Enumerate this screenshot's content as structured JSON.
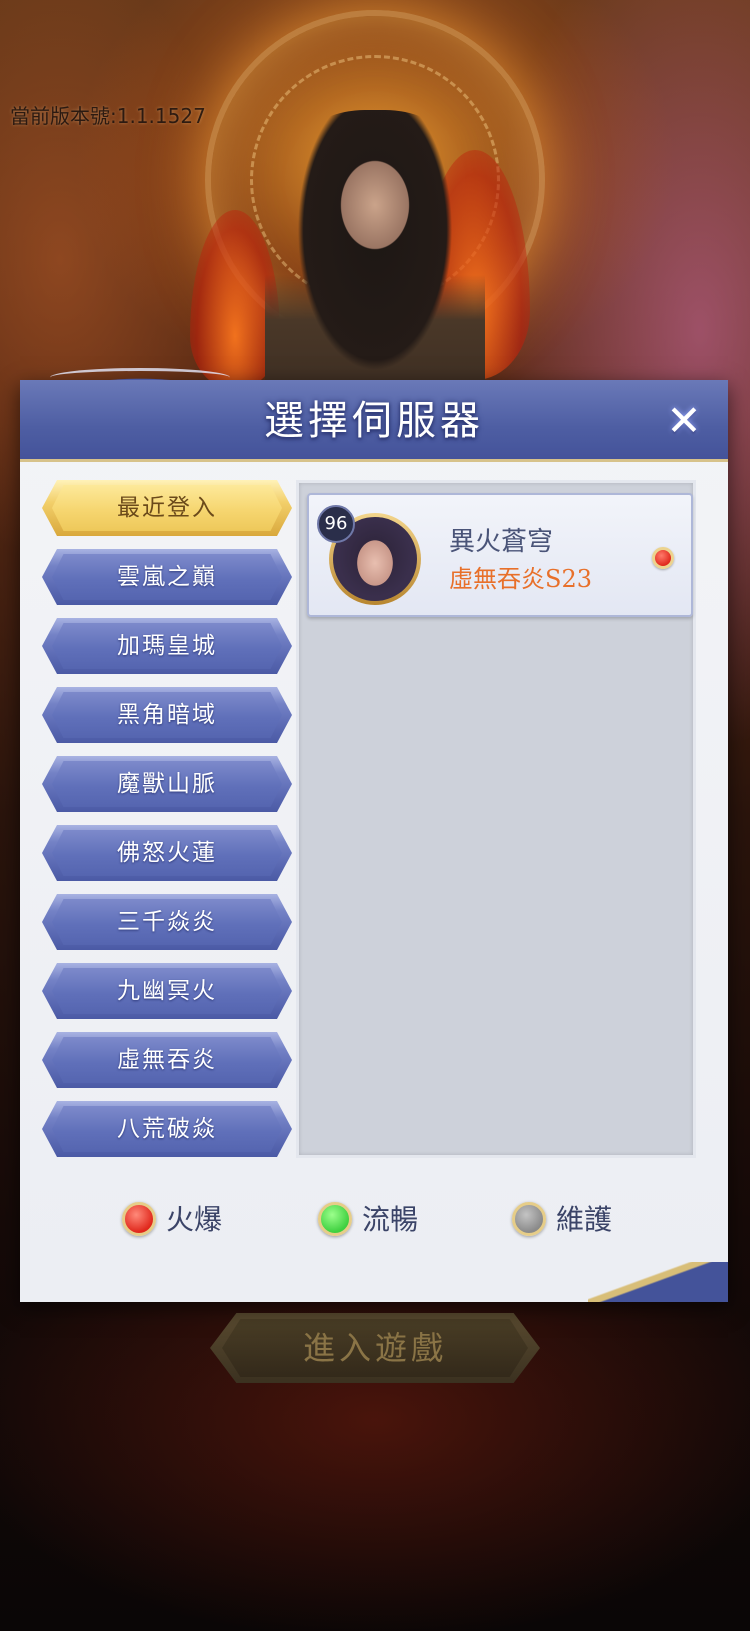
{
  "version_label": "當前版本號:1.1.1527",
  "modal": {
    "title": "選擇伺服器",
    "close_icon": "close-icon"
  },
  "categories": [
    {
      "label": "最近登入",
      "active": true
    },
    {
      "label": "雲嵐之巔",
      "active": false
    },
    {
      "label": "加瑪皇城",
      "active": false
    },
    {
      "label": "黑角暗域",
      "active": false
    },
    {
      "label": "魔獸山脈",
      "active": false
    },
    {
      "label": "佛怒火蓮",
      "active": false
    },
    {
      "label": "三千焱炎",
      "active": false
    },
    {
      "label": "九幽冥火",
      "active": false
    },
    {
      "label": "虛無吞炎",
      "active": false
    },
    {
      "label": "八荒破焱",
      "active": false
    }
  ],
  "recent_server": {
    "level": "96",
    "character_name": "異火蒼穹",
    "server_name": "虛無吞炎S23",
    "status": "hot"
  },
  "legend": [
    {
      "label": "火爆",
      "color": "#e0281c",
      "status": "hot"
    },
    {
      "label": "流暢",
      "color": "#3fd040",
      "status": "smooth"
    },
    {
      "label": "維護",
      "color": "#8a8a8a",
      "status": "maintenance"
    }
  ],
  "enter_button": {
    "label": "進入遊戲"
  },
  "colors": {
    "header": "#4e5ea3",
    "accent_gold": "#f2cf6a",
    "server_sub": "#e8702a"
  }
}
